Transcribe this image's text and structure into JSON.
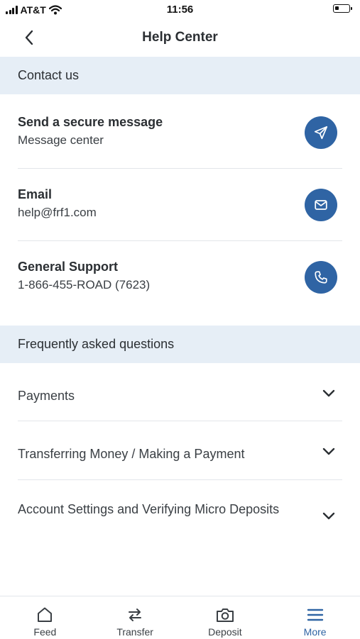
{
  "status_bar": {
    "carrier": "AT&T",
    "time": "11:56"
  },
  "header": {
    "title": "Help Center"
  },
  "contact": {
    "heading": "Contact us",
    "items": [
      {
        "title": "Send a secure message",
        "subtitle": "Message center",
        "icon": "send-icon"
      },
      {
        "title": "Email",
        "subtitle": "help@frf1.com",
        "icon": "mail-icon"
      },
      {
        "title": "General Support",
        "subtitle": "1-866-455-ROAD (7623)",
        "icon": "phone-icon"
      }
    ]
  },
  "faq": {
    "heading": "Frequently asked questions",
    "items": [
      {
        "question": "Payments"
      },
      {
        "question": "Transferring Money / Making a Payment"
      },
      {
        "question": "Account Settings and Verifying Micro Deposits"
      }
    ]
  },
  "tabs": [
    {
      "label": "Feed",
      "icon": "home-icon"
    },
    {
      "label": "Transfer",
      "icon": "transfer-arrows-icon"
    },
    {
      "label": "Deposit",
      "icon": "camera-icon"
    },
    {
      "label": "More",
      "icon": "menu-icon",
      "active": true
    }
  ],
  "colors": {
    "accent": "#2f64a4",
    "section_bg": "#e6eef6",
    "text": "#2b2f33"
  }
}
